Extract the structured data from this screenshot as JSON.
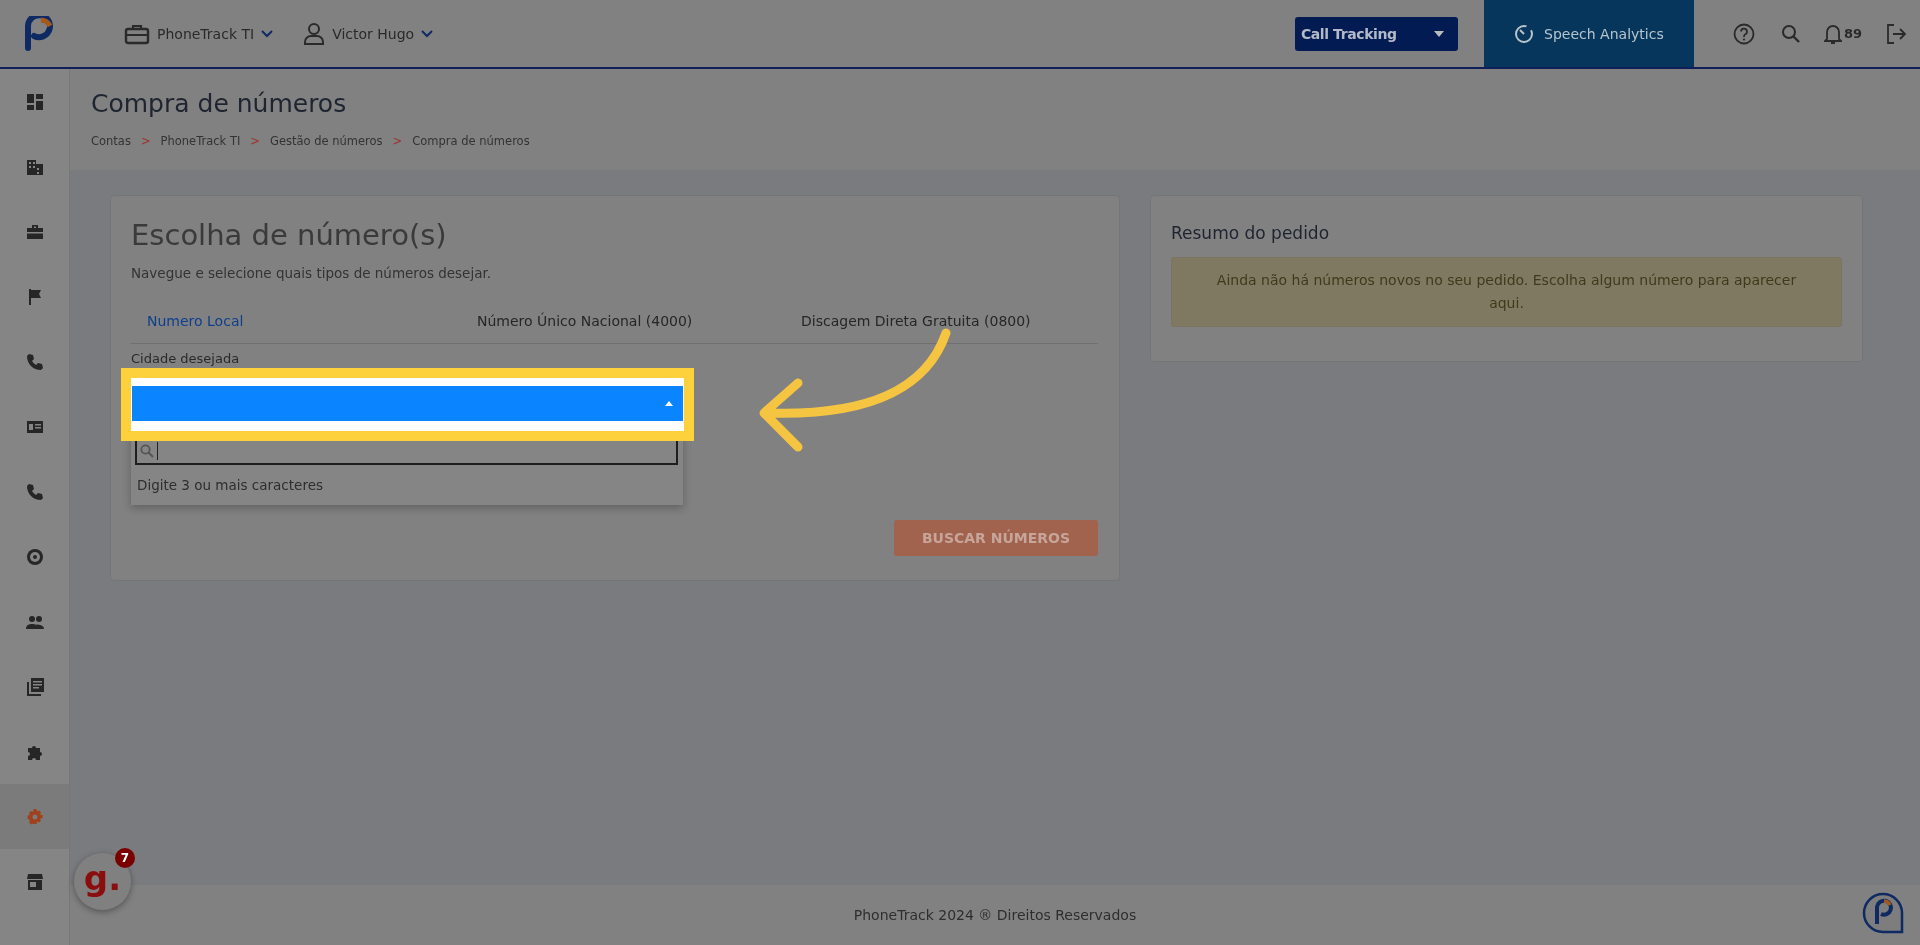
{
  "header": {
    "account_menu": "PhoneTrack TI",
    "user_menu": "Victor Hugo",
    "product_select": "Call Tracking",
    "speech_tab": "Speech Analytics",
    "notifications": "89"
  },
  "sidebar": {
    "items": [
      {
        "selected": false
      },
      {
        "selected": false
      },
      {
        "selected": false
      },
      {
        "selected": false
      },
      {
        "selected": false
      },
      {
        "selected": false
      },
      {
        "selected": false
      },
      {
        "selected": false
      },
      {
        "selected": false
      },
      {
        "selected": false
      },
      {
        "selected": false
      },
      {
        "selected": true
      },
      {
        "selected": false
      }
    ]
  },
  "page": {
    "title": "Compra de números",
    "breadcrumbs": [
      "Contas",
      "PhoneTrack TI",
      "Gestão de números",
      "Compra de números"
    ],
    "separator": ">"
  },
  "choice_card": {
    "title": "Escolha de número(s)",
    "subtitle": "Navegue e selecione quais tipos de números desejar.",
    "tabs": [
      {
        "label": "Numero Local",
        "selected": true
      },
      {
        "label": "Número Único Nacional (4000)",
        "selected": false
      },
      {
        "label": "Discagem Direta Gratuita (0800)",
        "selected": false
      }
    ],
    "field_label": "Cidade desejada",
    "dropdown": {
      "expanded": true,
      "hint": "Digite 3 ou mais caracteres"
    },
    "search_button": {
      "label": "BUSCAR NÚMEROS",
      "disabled": true
    }
  },
  "summary_card": {
    "title": "Resumo do pedido",
    "alert": "Ainda não há números novos no seu pedido. Escolha algum número para aparecer aqui."
  },
  "footer": {
    "text": "PhoneTrack 2024 ® Direitos Reservados"
  },
  "help_widget": {
    "label": "g.",
    "badge": "7"
  }
}
